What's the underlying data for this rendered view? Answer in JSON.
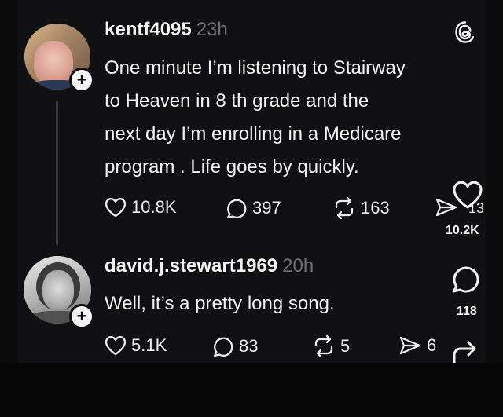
{
  "post": {
    "username": "kentf4095",
    "time": "23h",
    "text_lines": [
      "One minute I’m listening to Stairway",
      "to Heaven in 8 th grade and the",
      "next day I’m enrolling in a Medicare",
      "program . Life goes by quickly."
    ],
    "likes": "10.8K",
    "replies": "397",
    "reposts": "163",
    "shares": "13"
  },
  "reply": {
    "username": "david.j.stewart1969",
    "time": "20h",
    "text": "Well, it’s a pretty long song.",
    "likes": "5.1K",
    "replies": "83",
    "reposts": "5",
    "shares": "6"
  },
  "overlay": {
    "heart_count": "10.2K",
    "comment_count": "118"
  },
  "icons": {
    "app_logo": "threads-logo-icon",
    "like": "heart-icon",
    "reply": "speech-bubble-icon",
    "repost": "repost-icon",
    "share": "send-icon",
    "forward": "forward-arrow-icon",
    "follow": "plus-icon"
  },
  "colors": {
    "background": "#111113",
    "text": "#f2f2f2",
    "muted": "#6e6e73",
    "thread_line": "#3a3a3c"
  }
}
